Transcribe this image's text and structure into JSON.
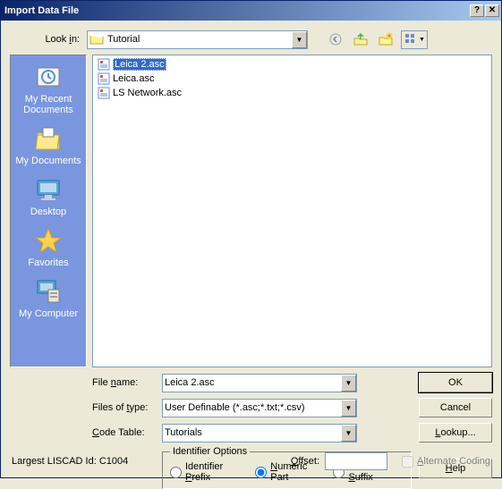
{
  "title": "Import Data File",
  "titlebar": {
    "help": "?",
    "close": "✕"
  },
  "lookin": {
    "label": "Look in:",
    "value": "Tutorial"
  },
  "sidebar": [
    {
      "label": "My Recent Documents"
    },
    {
      "label": "My Documents"
    },
    {
      "label": "Desktop"
    },
    {
      "label": "Favorites"
    },
    {
      "label": "My Computer"
    }
  ],
  "files": [
    {
      "name": "Leica 2.asc",
      "selected": true
    },
    {
      "name": "Leica.asc",
      "selected": false
    },
    {
      "name": "LS Network.asc",
      "selected": false
    }
  ],
  "fields": {
    "filename": {
      "label_pre": "File ",
      "label_u": "n",
      "label_post": "ame:",
      "value": "Leica 2.asc"
    },
    "filetype": {
      "label_pre": "Files of ",
      "label_u": "t",
      "label_post": "ype:",
      "value": "User Definable (*.asc;*.txt;*.csv)"
    },
    "codetable": {
      "label_u": "C",
      "label_post": "ode Table:",
      "value": "Tutorials"
    }
  },
  "buttons": {
    "ok": "OK",
    "cancel": "Cancel",
    "lookup": "Lookup...",
    "help": "Help"
  },
  "group": {
    "title": "Identifier Options",
    "prefix": "Identifier Prefix",
    "numeric": "Numeric Part",
    "suffix": "Identifier Suffix"
  },
  "bottom": {
    "largest": "Largest LISCAD Id: C1004",
    "offset_u": "O",
    "offset_post": "ffset:",
    "offset_value": "",
    "altcoding_u": "A",
    "altcoding_post": "lternate Coding"
  }
}
